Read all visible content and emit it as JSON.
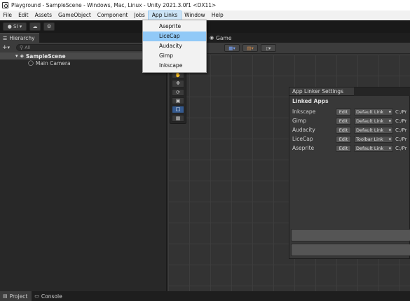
{
  "window": {
    "title": "Playground - SampleScene - Windows, Mac, Linux - Unity 2021.3.0f1 <DX11>"
  },
  "menubar": {
    "items": [
      "File",
      "Edit",
      "Assets",
      "GameObject",
      "Component",
      "Jobs",
      "App Links",
      "Window",
      "Help"
    ]
  },
  "toolbar": {
    "account_label": "SI",
    "account_icon": "account-icon",
    "cloud_icon": "cloud-icon",
    "settings_icon": "gear-icon"
  },
  "hierarchy": {
    "tab_label": "Hierarchy",
    "add_label": "+",
    "search_placeholder": "All",
    "scene_name": "SampleScene",
    "items": [
      "Main Camera"
    ]
  },
  "scene_view": {
    "game_tab_label": "Game",
    "toolbar_icons": [
      "grid-icon",
      "snap-icon",
      "gizmo-icon"
    ],
    "tools": [
      "hand-tool-icon",
      "move-tool-icon",
      "rotate-tool-icon",
      "scale-tool-icon",
      "rect-tool-icon",
      "transform-tool-icon"
    ],
    "selected_tool_index": 4
  },
  "app_links_menu": {
    "items": [
      "Aseprite",
      "LiceCap",
      "Audacity",
      "Gimp",
      "Inkscape"
    ],
    "highlighted_index": 1
  },
  "app_linker": {
    "tab_label": "App Linker Settings",
    "section_title": "Linked Apps",
    "rows": [
      {
        "name": "Inkscape",
        "edit": "Edit",
        "link_type": "Default Link",
        "path": "C:/Pr"
      },
      {
        "name": "Gimp",
        "edit": "Edit",
        "link_type": "Default Link",
        "path": "C:/Pr"
      },
      {
        "name": "Audacity",
        "edit": "Edit",
        "link_type": "Default Link",
        "path": "C:/Pr"
      },
      {
        "name": "LiceCap",
        "edit": "Edit",
        "link_type": "Toolbar Link",
        "path": "C:/Pr"
      },
      {
        "name": "Aseprite",
        "edit": "Edit",
        "link_type": "Default Link",
        "path": "C:/Pr"
      }
    ]
  },
  "bottom_tabs": [
    "Project",
    "Console"
  ]
}
